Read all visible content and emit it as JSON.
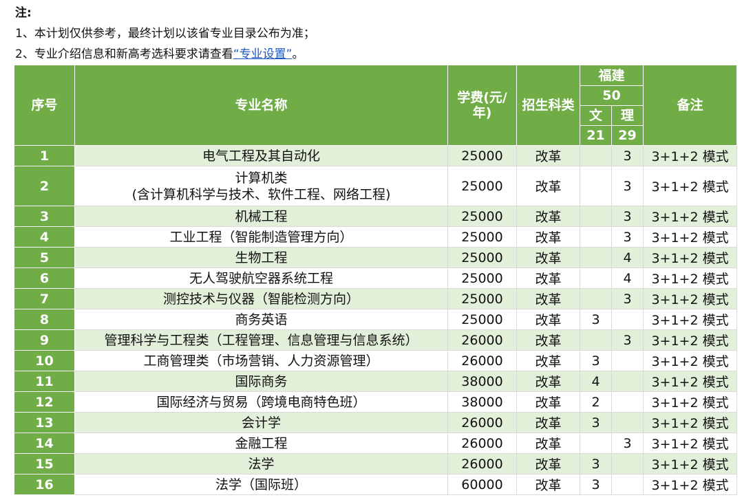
{
  "notes": {
    "title": "注:",
    "line1": "1、本计划仅供参考，最终计划以该省专业目录公布为准；",
    "line2_pre": "2、专业介绍信息和新高考选科要求请查看",
    "line2_link": "“专业设置”",
    "line2_post": "。"
  },
  "table": {
    "headers": {
      "seq": "序号",
      "name": "专业名称",
      "fee": "学费(元/年)",
      "type": "招生科类",
      "province": "福建",
      "province_total": "50",
      "wen": "文",
      "li": "理",
      "wen_total": "21",
      "li_total": "29",
      "remark": "备注"
    },
    "rows": [
      {
        "seq": "1",
        "name": "电气工程及其自动化",
        "name2": "",
        "fee": "25000",
        "type": "改革",
        "wen": "",
        "li": "3",
        "remark": "3+1+2 模式"
      },
      {
        "seq": "2",
        "name": "计算机类",
        "name2": "(含计算机科学与技术、软件工程、网络工程)",
        "fee": "25000",
        "type": "改革",
        "wen": "",
        "li": "3",
        "remark": "3+1+2 模式"
      },
      {
        "seq": "3",
        "name": "机械工程",
        "name2": "",
        "fee": "25000",
        "type": "改革",
        "wen": "",
        "li": "3",
        "remark": "3+1+2 模式"
      },
      {
        "seq": "4",
        "name": "工业工程（智能制造管理方向）",
        "name2": "",
        "fee": "25000",
        "type": "改革",
        "wen": "",
        "li": "3",
        "remark": "3+1+2 模式"
      },
      {
        "seq": "5",
        "name": "生物工程",
        "name2": "",
        "fee": "25000",
        "type": "改革",
        "wen": "",
        "li": "4",
        "remark": "3+1+2 模式"
      },
      {
        "seq": "6",
        "name": "无人驾驶航空器系统工程",
        "name2": "",
        "fee": "25000",
        "type": "改革",
        "wen": "",
        "li": "4",
        "remark": "3+1+2 模式"
      },
      {
        "seq": "7",
        "name": "测控技术与仪器（智能检测方向）",
        "name2": "",
        "fee": "25000",
        "type": "改革",
        "wen": "",
        "li": "3",
        "remark": "3+1+2 模式"
      },
      {
        "seq": "8",
        "name": "商务英语",
        "name2": "",
        "fee": "25000",
        "type": "改革",
        "wen": "3",
        "li": "",
        "remark": "3+1+2 模式"
      },
      {
        "seq": "9",
        "name": "管理科学与工程类（工程管理、信息管理与信息系统）",
        "name2": "",
        "fee": "26000",
        "type": "改革",
        "wen": "",
        "li": "3",
        "remark": "3+1+2 模式"
      },
      {
        "seq": "10",
        "name": "工商管理类（市场营销、人力资源管理）",
        "name2": "",
        "fee": "26000",
        "type": "改革",
        "wen": "3",
        "li": "",
        "remark": "3+1+2 模式"
      },
      {
        "seq": "11",
        "name": "国际商务",
        "name2": "",
        "fee": "38000",
        "type": "改革",
        "wen": "4",
        "li": "",
        "remark": "3+1+2 模式"
      },
      {
        "seq": "12",
        "name": "国际经济与贸易（跨境电商特色班）",
        "name2": "",
        "fee": "38000",
        "type": "改革",
        "wen": "2",
        "li": "",
        "remark": "3+1+2 模式"
      },
      {
        "seq": "13",
        "name": "会计学",
        "name2": "",
        "fee": "26000",
        "type": "改革",
        "wen": "3",
        "li": "",
        "remark": "3+1+2 模式"
      },
      {
        "seq": "14",
        "name": "金融工程",
        "name2": "",
        "fee": "26000",
        "type": "改革",
        "wen": "",
        "li": "3",
        "remark": "3+1+2 模式"
      },
      {
        "seq": "15",
        "name": "法学",
        "name2": "",
        "fee": "26000",
        "type": "改革",
        "wen": "3",
        "li": "",
        "remark": "3+1+2 模式"
      },
      {
        "seq": "16",
        "name": "法学（国际班）",
        "name2": "",
        "fee": "60000",
        "type": "改革",
        "wen": "3",
        "li": "",
        "remark": "3+1+2 模式"
      }
    ]
  },
  "colors": {
    "header_green": "#70ad47",
    "row_light_green": "#e2efd9",
    "link_blue": "#1a56c4"
  }
}
